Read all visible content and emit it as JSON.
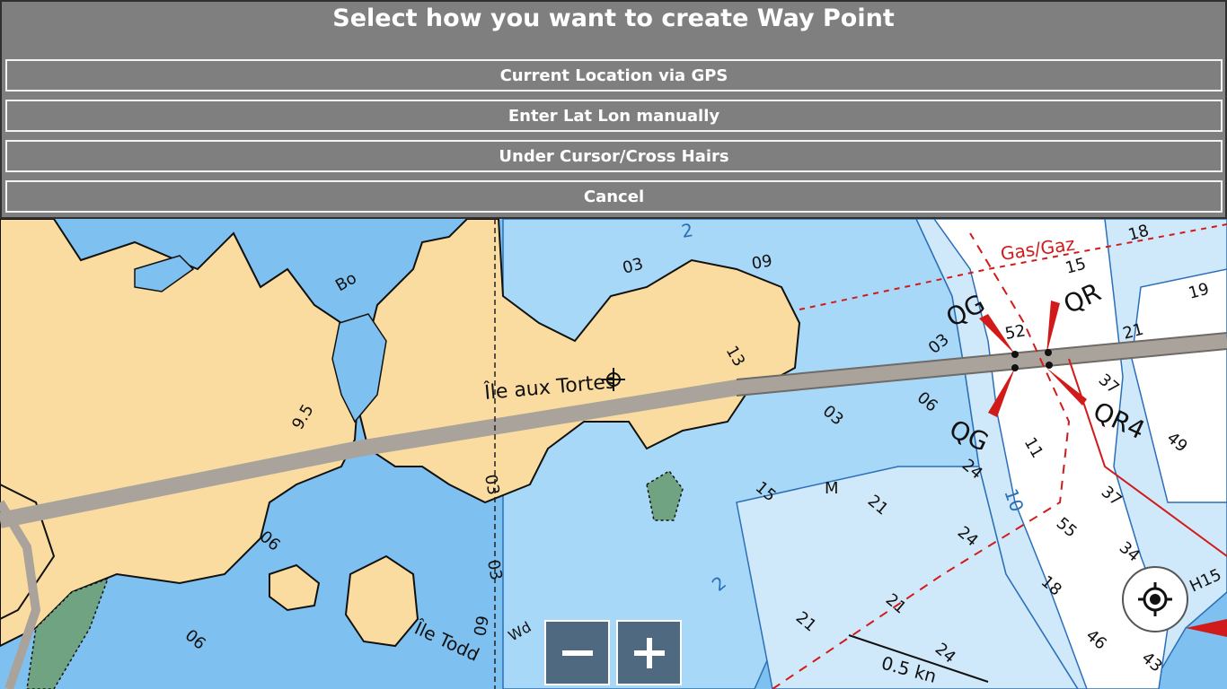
{
  "dialog": {
    "title": "Select how you want to create Way Point",
    "options": [
      {
        "label": "Current Location via GPS"
      },
      {
        "label": "Enter Lat Lon manually"
      },
      {
        "label": "Under Cursor/Cross Hairs"
      },
      {
        "label": "Cancel"
      }
    ]
  },
  "map": {
    "labels": {
      "ile_tortes": "Île aux Tortes",
      "ile_todd": "Île Todd",
      "gas": "Gas/Gaz",
      "qg1": "QG",
      "qg2": "QG",
      "qr1": "QR",
      "qr4": "QR4",
      "bo": "Bo",
      "wd": "Wd",
      "m": "M",
      "current": "0.5 kn",
      "h15": "H15"
    },
    "soundings": [
      "03",
      "09",
      "03",
      "06",
      "03",
      "15",
      "21",
      "24",
      "10",
      "11",
      "55",
      "24",
      "21",
      "21",
      "24",
      "37",
      "34",
      "46",
      "43",
      "18",
      "15",
      "18",
      "19",
      "21",
      "37",
      "52",
      "49",
      "06",
      "06",
      "03",
      "09",
      "03",
      "2",
      "2",
      "13",
      "9.5"
    ],
    "colors": {
      "land": "#fbdca0",
      "shallow": "#7ec0ef",
      "mid": "#a8d8f7",
      "deep": "#e8f4fd",
      "channel": "#ffffff",
      "bridge": "#a9a39c",
      "navaid": "#d11a1a",
      "marsh": "#6fa381"
    }
  },
  "controls": {
    "zoom_out_icon": "minus-icon",
    "zoom_in_icon": "plus-icon",
    "locate_icon": "gps-target-icon"
  }
}
